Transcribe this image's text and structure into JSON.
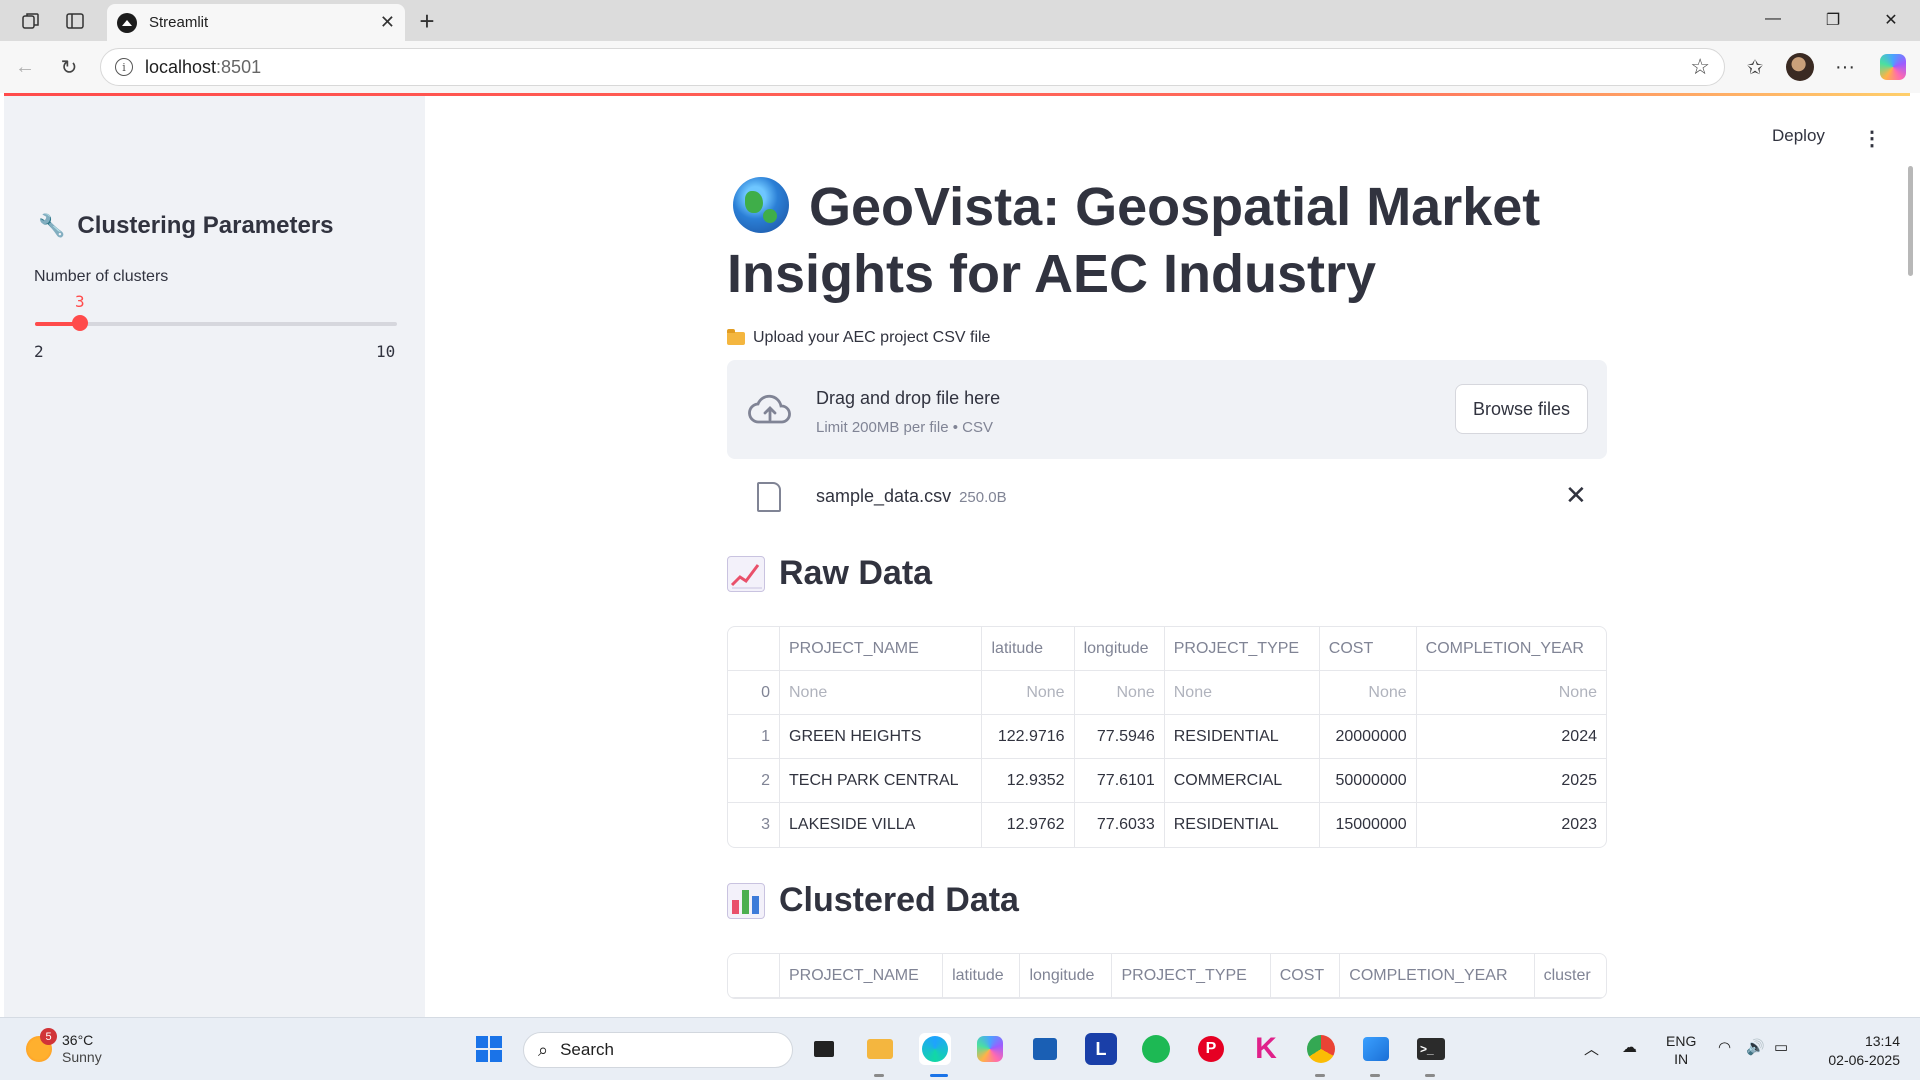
{
  "browser": {
    "tab_title": "Streamlit",
    "url_host": "localhost",
    "url_port": ":8501"
  },
  "app": {
    "deploy_label": "Deploy",
    "menu_icon": "kebab-icon"
  },
  "sidebar": {
    "heading": "Clustering Parameters",
    "heading_icon": "wrench-icon",
    "slider": {
      "label": "Number of clusters",
      "value": 3,
      "value_text": "3",
      "min": 2,
      "min_text": "2",
      "max": 10,
      "max_text": "10",
      "accent": "#ff4b4b"
    }
  },
  "main": {
    "title": "GeoVista: Geospatial Market Insights for AEC Industry",
    "title_icon": "globe-icon",
    "uploader": {
      "label": "Upload your AEC project CSV file",
      "drop_title": "Drag and drop file here",
      "drop_sub": "Limit 200MB per file • CSV",
      "browse_label": "Browse files",
      "file_name": "sample_data.csv",
      "file_size": "250.0B"
    },
    "raw": {
      "heading": "Raw Data",
      "heading_icon": "chart-increasing-icon",
      "columns": [
        "",
        "PROJECT_NAME",
        "latitude",
        "longitude",
        "PROJECT_TYPE",
        "COST",
        "COMPLETION_YEAR"
      ],
      "rows": [
        [
          "0",
          "None",
          "None",
          "None",
          "None",
          "None",
          "None"
        ],
        [
          "1",
          "GREEN HEIGHTS",
          "122.9716",
          "77.5946",
          "RESIDENTIAL",
          "20000000",
          "2024"
        ],
        [
          "2",
          "TECH PARK CENTRAL",
          "12.9352",
          "77.6101",
          "COMMERCIAL",
          "50000000",
          "2025"
        ],
        [
          "3",
          "LAKESIDE VILLA",
          "12.9762",
          "77.6033",
          "RESIDENTIAL",
          "15000000",
          "2023"
        ]
      ]
    },
    "clustered": {
      "heading": "Clustered Data",
      "heading_icon": "bar-chart-icon",
      "columns": [
        "",
        "PROJECT_NAME",
        "latitude",
        "longitude",
        "PROJECT_TYPE",
        "COST",
        "COMPLETION_YEAR",
        "cluster"
      ]
    }
  },
  "taskbar": {
    "weather_temp": "36°C",
    "weather_desc": "Sunny",
    "weather_badge": "5",
    "search_label": "Search",
    "lang_top": "ENG",
    "lang_bottom": "IN",
    "time": "13:14",
    "date": "02-06-2025"
  }
}
